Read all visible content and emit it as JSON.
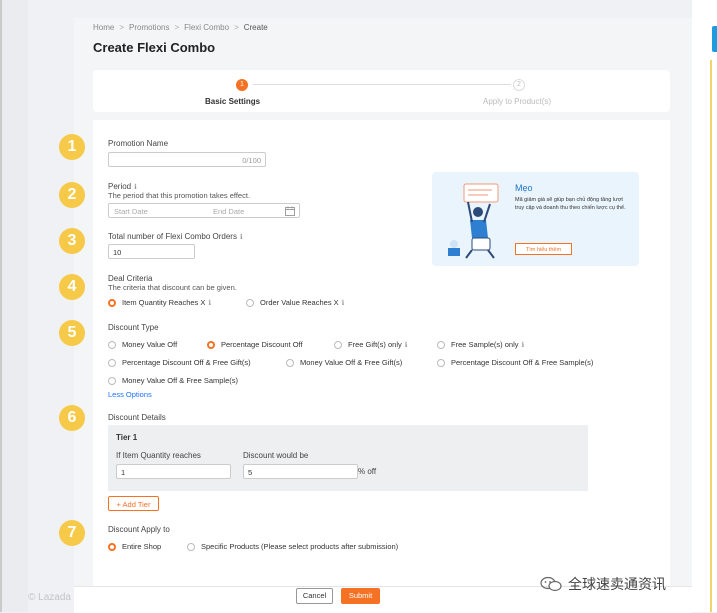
{
  "breadcrumb": [
    "Home",
    "Promotions",
    "Flexi Combo",
    "Create"
  ],
  "page_title": "Create Flexi Combo",
  "steps": [
    {
      "number": "1",
      "label": "Basic Settings"
    },
    {
      "number": "2",
      "label": "Apply to Product(s)"
    }
  ],
  "annotations": [
    "1",
    "2",
    "3",
    "4",
    "5",
    "6",
    "7"
  ],
  "promotion_name": {
    "label": "Promotion Name",
    "counter": "0/100",
    "value": ""
  },
  "period": {
    "label": "Period",
    "description": "The period that this promotion takes effect.",
    "start_placeholder": "Start Date",
    "end_placeholder": "End Date"
  },
  "total_orders": {
    "label": "Total number of Flexi Combo Orders",
    "value": "10"
  },
  "deal_criteria": {
    "label": "Deal Criteria",
    "description": "The criteria that discount can be given.",
    "options": [
      {
        "label": "Item Quantity Reaches X",
        "selected": true
      },
      {
        "label": "Order Value Reaches X",
        "selected": false
      }
    ]
  },
  "discount_type": {
    "label": "Discount Type",
    "options": [
      {
        "label": "Money Value Off",
        "selected": false
      },
      {
        "label": "Percentage Discount Off",
        "selected": true
      },
      {
        "label": "Free Gift(s) only",
        "selected": false
      },
      {
        "label": "Free Sample(s) only",
        "selected": false
      },
      {
        "label": "Percentage Discount Off & Free Gift(s)",
        "selected": false
      },
      {
        "label": "Money Value Off & Free Gift(s)",
        "selected": false
      },
      {
        "label": "Percentage Discount Off & Free Sample(s)",
        "selected": false
      },
      {
        "label": "Money Value Off & Free Sample(s)",
        "selected": false
      }
    ],
    "less_options": "Less Options"
  },
  "discount_details": {
    "label": "Discount Details",
    "tier_title": "Tier 1",
    "quantity_label": "If Item Quantity reaches",
    "quantity_value": "1",
    "discount_label": "Discount would be",
    "discount_value": "5",
    "discount_suffix": "% off",
    "add_tier": "+ Add Tier"
  },
  "apply_to": {
    "label": "Discount Apply to",
    "options": [
      {
        "label": "Entire Shop",
        "selected": true
      },
      {
        "label": "Specific Products (Please select products after submission)",
        "selected": false
      }
    ]
  },
  "tip": {
    "title": "Mẹo",
    "body": "Mã giảm giá sẽ giúp bạn chủ động tăng lượt truy cập và doanh thu theo chiến lược cụ thể.",
    "button": "Tìm hiểu thêm"
  },
  "footer": {
    "cancel": "Cancel",
    "submit": "Submit"
  },
  "watermark": {
    "left_text": "© Lazada",
    "wechat_text": "全球速卖通资讯"
  },
  "colors": {
    "accent": "#f57224",
    "annotation": "#f7c948",
    "link": "#1a71ff",
    "tip_title": "#1d75c7"
  }
}
